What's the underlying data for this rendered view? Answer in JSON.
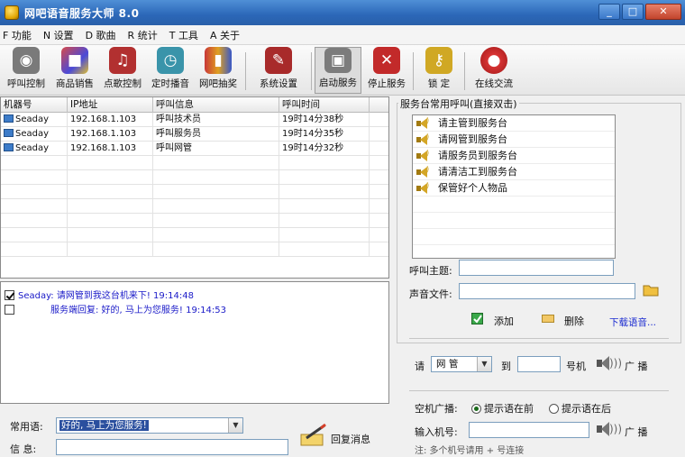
{
  "window": {
    "title": "网吧语音服务大师 8.0",
    "controls": [
      "_",
      "□",
      "✕"
    ]
  },
  "menu": [
    {
      "key": "F",
      "label": "功能"
    },
    {
      "key": "N",
      "label": "设置"
    },
    {
      "key": "D",
      "label": "歌曲"
    },
    {
      "key": "R",
      "label": "统计"
    },
    {
      "key": "T",
      "label": "工具"
    },
    {
      "key": "A",
      "label": "关于"
    }
  ],
  "toolbar": {
    "buttons": [
      {
        "label": "呼叫控制",
        "icon": "speaker-device-icon",
        "color": "#6b6b6b"
      },
      {
        "label": "商品销售",
        "icon": "goods-boxes-icon",
        "color": "#c43a3a"
      },
      {
        "label": "点歌控制",
        "icon": "music-control-icon",
        "color": "#b02828"
      },
      {
        "label": "定时播音",
        "icon": "timer-broadcast-icon",
        "color": "#2f8aa0"
      },
      {
        "label": "网吧抽奖",
        "icon": "lottery-gift-icon",
        "color": "#d08a18"
      },
      {
        "label": "系统设置",
        "icon": "system-settings-icon",
        "color": "#a02424"
      },
      {
        "label": "启动服务",
        "icon": "start-service-icon",
        "color": "#6a6a6a"
      },
      {
        "label": "停止服务",
        "icon": "stop-service-icon",
        "color": "#c02020"
      },
      {
        "label": "锁  定",
        "icon": "lock-key-icon",
        "color": "#c8a020"
      },
      {
        "label": "在线交流",
        "icon": "online-chat-icon",
        "color": "#c82020"
      }
    ]
  },
  "call_table": {
    "columns": [
      "机器号",
      "IP地址",
      "呼叫信息",
      "呼叫时间"
    ],
    "rows": [
      {
        "machine": "Seaday",
        "ip": "192.168.1.103",
        "info": "呼叫技术员",
        "time": "19时14分38秒"
      },
      {
        "machine": "Seaday",
        "ip": "192.168.1.103",
        "info": "呼叫服务员",
        "time": "19时14分35秒"
      },
      {
        "machine": "Seaday",
        "ip": "192.168.1.103",
        "info": "呼叫网管",
        "time": "19时14分32秒"
      }
    ]
  },
  "log": {
    "lines": [
      {
        "checked": true,
        "text": "Seaday: 请网管到我这台机来下! 19:14:48"
      },
      {
        "checked": false,
        "text": "服务端回复: 好的, 马上为您服务! 19:14:53"
      }
    ]
  },
  "reply": {
    "phrase_label": "常用语:",
    "phrase_value": "好的, 马上为您服务!",
    "message_label": "信  息:",
    "reply_button": "回复消息"
  },
  "service_calls": {
    "group_title": "服务台常用呼叫(直接双击)",
    "items": [
      "请主管到服务台",
      "请网管到服务台",
      "请服务员到服务台",
      "请清洁工到服务台",
      "保管好个人物品"
    ],
    "topic_label": "呼叫主题:",
    "sound_label": "声音文件:",
    "add_label": "添加",
    "delete_label": "删除",
    "download_label": "下载语音..."
  },
  "broadcast": {
    "prefix": "请",
    "role_value": "网 管",
    "to_label": "到",
    "machine_suffix": "号机",
    "broadcast_label": "广 播"
  },
  "idle_broadcast": {
    "label": "空机广播:",
    "option_before": "提示语在前",
    "option_after": "提示语在后",
    "input_label": "输入机号:",
    "broadcast_label": "广 播",
    "note": "注: 多个机号请用 + 号连接"
  }
}
